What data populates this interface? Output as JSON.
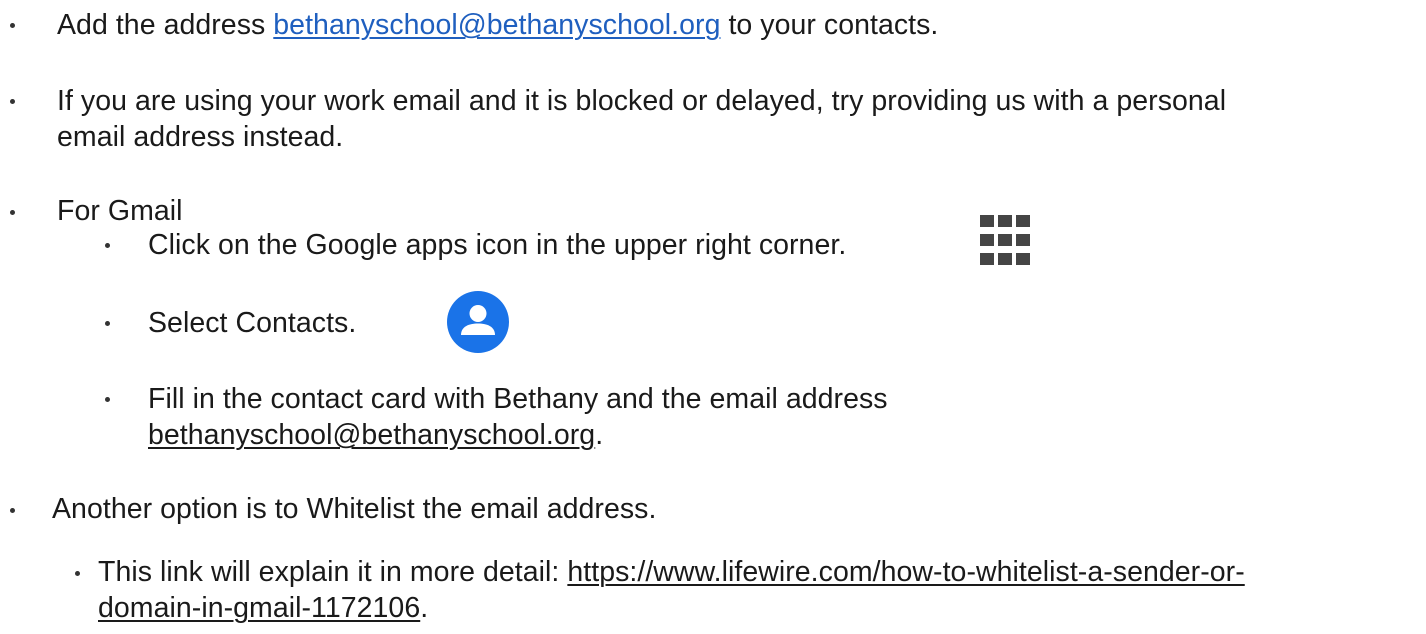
{
  "items": [
    {
      "prefix": "Add the address ",
      "link": "bethanyschool@bethanyschool.org",
      "suffix": " to your contacts."
    },
    {
      "line1": "If you are using your work email and it is blocked or delayed, try providing us with a personal",
      "line2": "email address instead."
    },
    {
      "label": "For Gmail",
      "subitems": [
        {
          "text": "Click on the Google apps icon in the upper right corner.",
          "icon": "google-apps-grid-icon"
        },
        {
          "text": "Select Contacts.",
          "icon": "google-contacts-icon"
        },
        {
          "line1": "Fill in the contact card with Bethany and the email address",
          "link": "bethanyschool@bethanyschool.org",
          "suffix": "."
        }
      ]
    },
    {
      "label": "Another option is to Whitelist the email address.",
      "subitems": [
        {
          "prefix": "This link will explain it in more detail: ",
          "link_part1": "https://www.lifewire.com/how-to-whitelist-a-sender-or-",
          "link_part2": "domain-in-gmail-1172106",
          "suffix": "."
        }
      ]
    }
  ],
  "colors": {
    "link": "#1f5fbf",
    "text": "#1a1a1a",
    "contacts_icon": "#1a73e8",
    "apps_icon": "#454545"
  }
}
